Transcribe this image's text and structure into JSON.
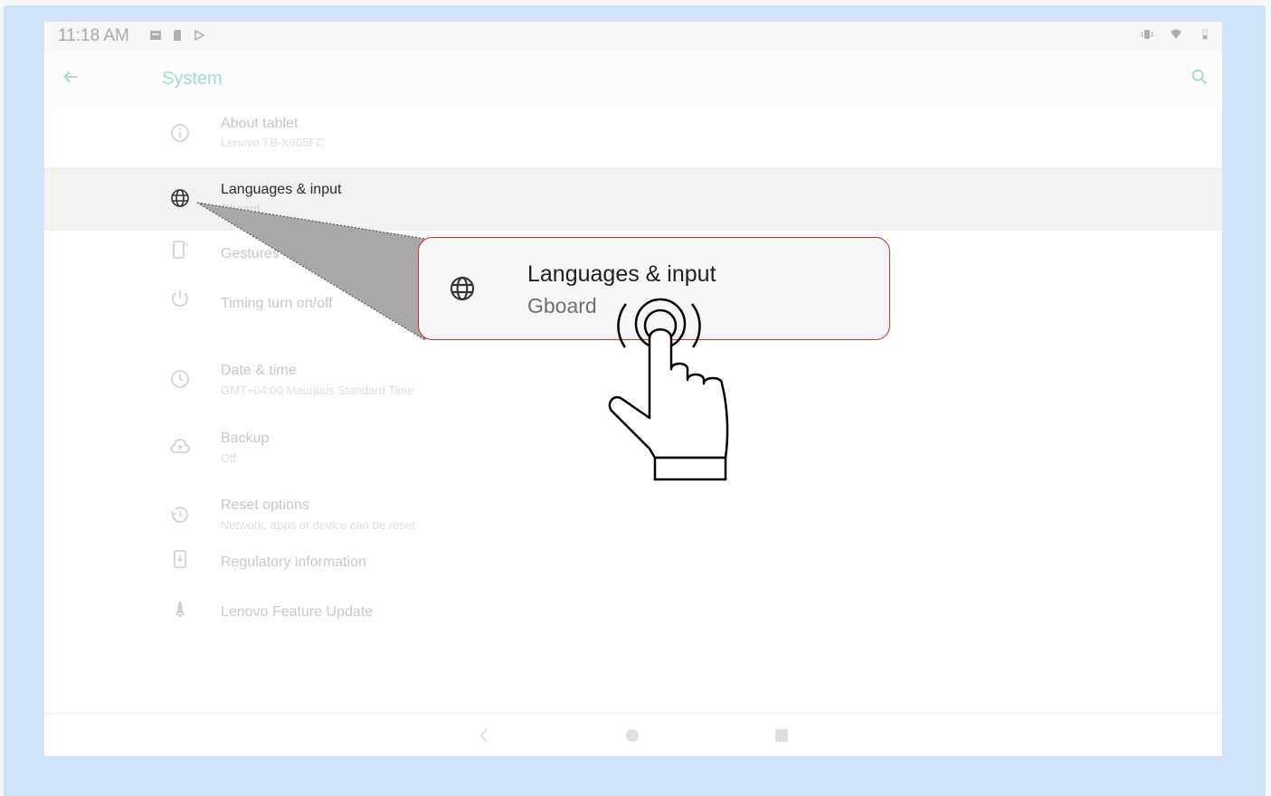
{
  "status_bar": {
    "time": "11:18 AM"
  },
  "app_bar": {
    "title": "System"
  },
  "items": [
    {
      "title": "About tablet",
      "subtitle": "Lenovo TB-X605FC",
      "icon": "info-icon"
    },
    {
      "title": "Languages & input",
      "subtitle": "Gboard",
      "icon": "globe-icon",
      "selected": true
    },
    {
      "title": "Gestures",
      "subtitle": "",
      "icon": "gesture-phone-icon"
    },
    {
      "title": "Timing turn on/off",
      "subtitle": "",
      "icon": "power-icon"
    },
    {
      "title": "Date & time",
      "subtitle": "GMT+04:00 Mauritius Standard Time",
      "icon": "clock-icon"
    },
    {
      "title": "Backup",
      "subtitle": "Off",
      "icon": "cloud-upload-icon"
    },
    {
      "title": "Reset options",
      "subtitle": "Network, apps or device can be reset",
      "icon": "history-icon"
    },
    {
      "title": "Regulatory information",
      "subtitle": "",
      "icon": "regulatory-icon"
    },
    {
      "title": "Lenovo Feature Update",
      "subtitle": "",
      "icon": "rocket-icon"
    }
  ],
  "callout": {
    "title": "Languages & input",
    "subtitle": "Gboard",
    "icon": "globe-icon",
    "border_color": "#e02b2b"
  },
  "colors": {
    "accent": "#a3d9d1",
    "background": "#cfe2f7"
  }
}
